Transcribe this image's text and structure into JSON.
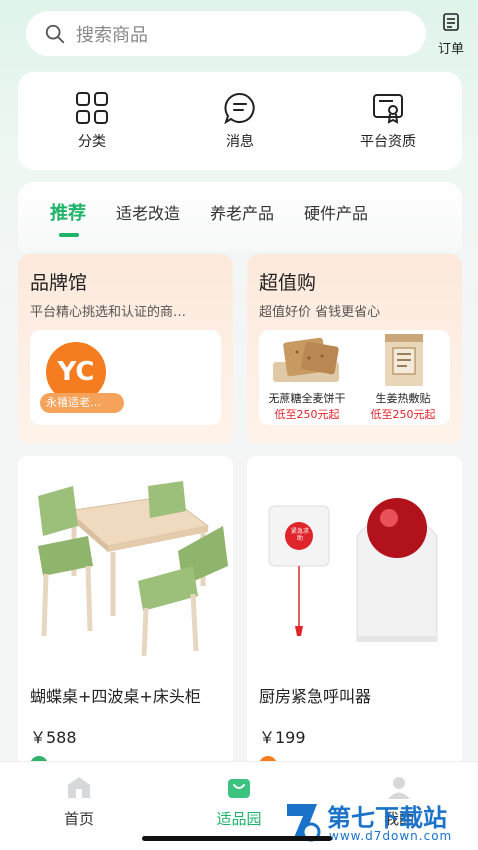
{
  "search": {
    "placeholder": "搜索商品"
  },
  "orders": {
    "label": "订单"
  },
  "quick_actions": [
    {
      "label": "分类",
      "icon": "grid-icon"
    },
    {
      "label": "消息",
      "icon": "message-icon"
    },
    {
      "label": "平台资质",
      "icon": "certificate-icon"
    }
  ],
  "tabs": [
    {
      "label": "推荐",
      "active": true
    },
    {
      "label": "适老改造"
    },
    {
      "label": "养老产品"
    },
    {
      "label": "硬件产品"
    }
  ],
  "brand_hall": {
    "title": "品牌馆",
    "subtitle": "平台精心挑选和认证的商…",
    "brand_logo_text": "YC",
    "brand_name": "永禧适老…"
  },
  "value_buy": {
    "title": "超值购",
    "subtitle": "超值好价 省钱更省心",
    "items": [
      {
        "name": "无蔗糖全麦饼干",
        "price": "低至250元起"
      },
      {
        "name": "生姜热敷贴",
        "price": "低至250元起"
      }
    ]
  },
  "products": [
    {
      "name": "蝴蝶桌+四波桌+床头柜",
      "price": "￥588"
    },
    {
      "name": "厨房紧急呼叫器",
      "price": "￥199",
      "button_text": "紧急求助"
    }
  ],
  "bottom_nav": [
    {
      "label": "首页",
      "icon": "home-icon"
    },
    {
      "label": "适品园",
      "icon": "shopping-bag-icon",
      "active": true
    },
    {
      "label": "我的",
      "icon": "user-icon"
    }
  ],
  "watermark": {
    "text": "第七下载站",
    "url": "www.d7down.com"
  },
  "colors": {
    "accent": "#1fb36a",
    "price_red": "#e0242b",
    "brand_orange": "#f57c1f"
  }
}
